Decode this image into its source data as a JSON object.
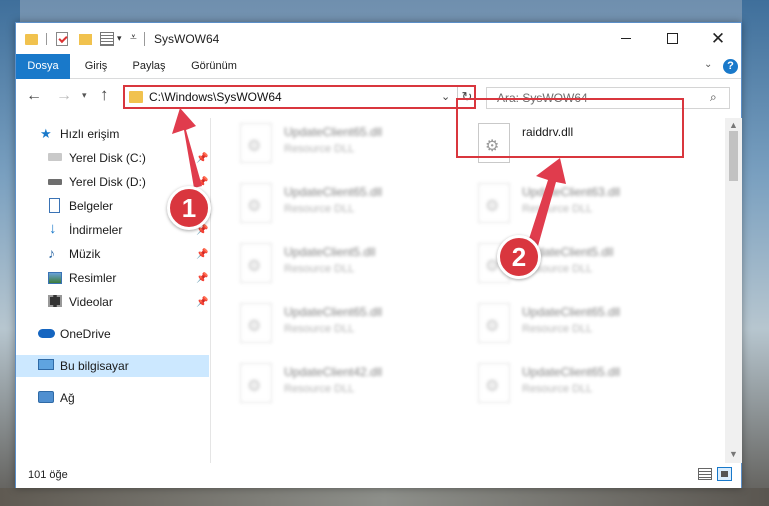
{
  "window": {
    "title": "SysWOW64"
  },
  "ribbon": {
    "tabs": [
      {
        "label": "Dosya"
      },
      {
        "label": "Giriş"
      },
      {
        "label": "Paylaş"
      },
      {
        "label": "Görünüm"
      }
    ],
    "help_label": "?"
  },
  "navbar": {
    "address": "C:\\Windows\\SysWOW64",
    "search_placeholder": "Ara: SysWOW64"
  },
  "sidebar": {
    "items": [
      {
        "label": "Hızlı erişim",
        "icon": "star-icon",
        "pinned": false
      },
      {
        "label": "Yerel Disk (C:)",
        "icon": "drive-icon",
        "pinned": true
      },
      {
        "label": "Yerel Disk (D:)",
        "icon": "drive-icon",
        "pinned": true
      },
      {
        "label": "Belgeler",
        "icon": "documents-icon",
        "pinned": true
      },
      {
        "label": "İndirmeler",
        "icon": "download-icon",
        "pinned": true
      },
      {
        "label": "Müzik",
        "icon": "music-icon",
        "pinned": true
      },
      {
        "label": "Resimler",
        "icon": "pictures-icon",
        "pinned": true
      },
      {
        "label": "Videolar",
        "icon": "videos-icon",
        "pinned": true
      },
      {
        "label": "OneDrive",
        "icon": "cloud-icon",
        "pinned": false
      },
      {
        "label": "Bu bilgisayar",
        "icon": "computer-icon",
        "pinned": false,
        "selected": true
      },
      {
        "label": "Ağ",
        "icon": "network-icon",
        "pinned": false
      }
    ]
  },
  "files": [
    {
      "name": "UpdateClient65.dll",
      "type": "Resource DLL",
      "blurred": true
    },
    {
      "name": "raiddrv.dll",
      "type": "",
      "blurred": false,
      "highlighted": true
    },
    {
      "name": "UpdateClient65.dll",
      "type": "Resource DLL",
      "blurred": true
    },
    {
      "name": "UpdateClient63.dll",
      "type": "Resource DLL",
      "blurred": true
    },
    {
      "name": "UpdateClient5.dll",
      "type": "Resource DLL",
      "blurred": true
    },
    {
      "name": "UpdateClient5.dll",
      "type": "Resource DLL",
      "blurred": true
    },
    {
      "name": "UpdateClient65.dll",
      "type": "Resource DLL",
      "blurred": true
    },
    {
      "name": "UpdateClient65.dll",
      "type": "Resource DLL",
      "blurred": true
    },
    {
      "name": "UpdateClient42.dll",
      "type": "Resource DLL",
      "blurred": true
    },
    {
      "name": "UpdateClient65.dll",
      "type": "Resource DLL",
      "blurred": true
    }
  ],
  "statusbar": {
    "item_count": "101 öğe"
  },
  "annotations": {
    "step1": "1",
    "step2": "2",
    "color": "#d9363e"
  }
}
